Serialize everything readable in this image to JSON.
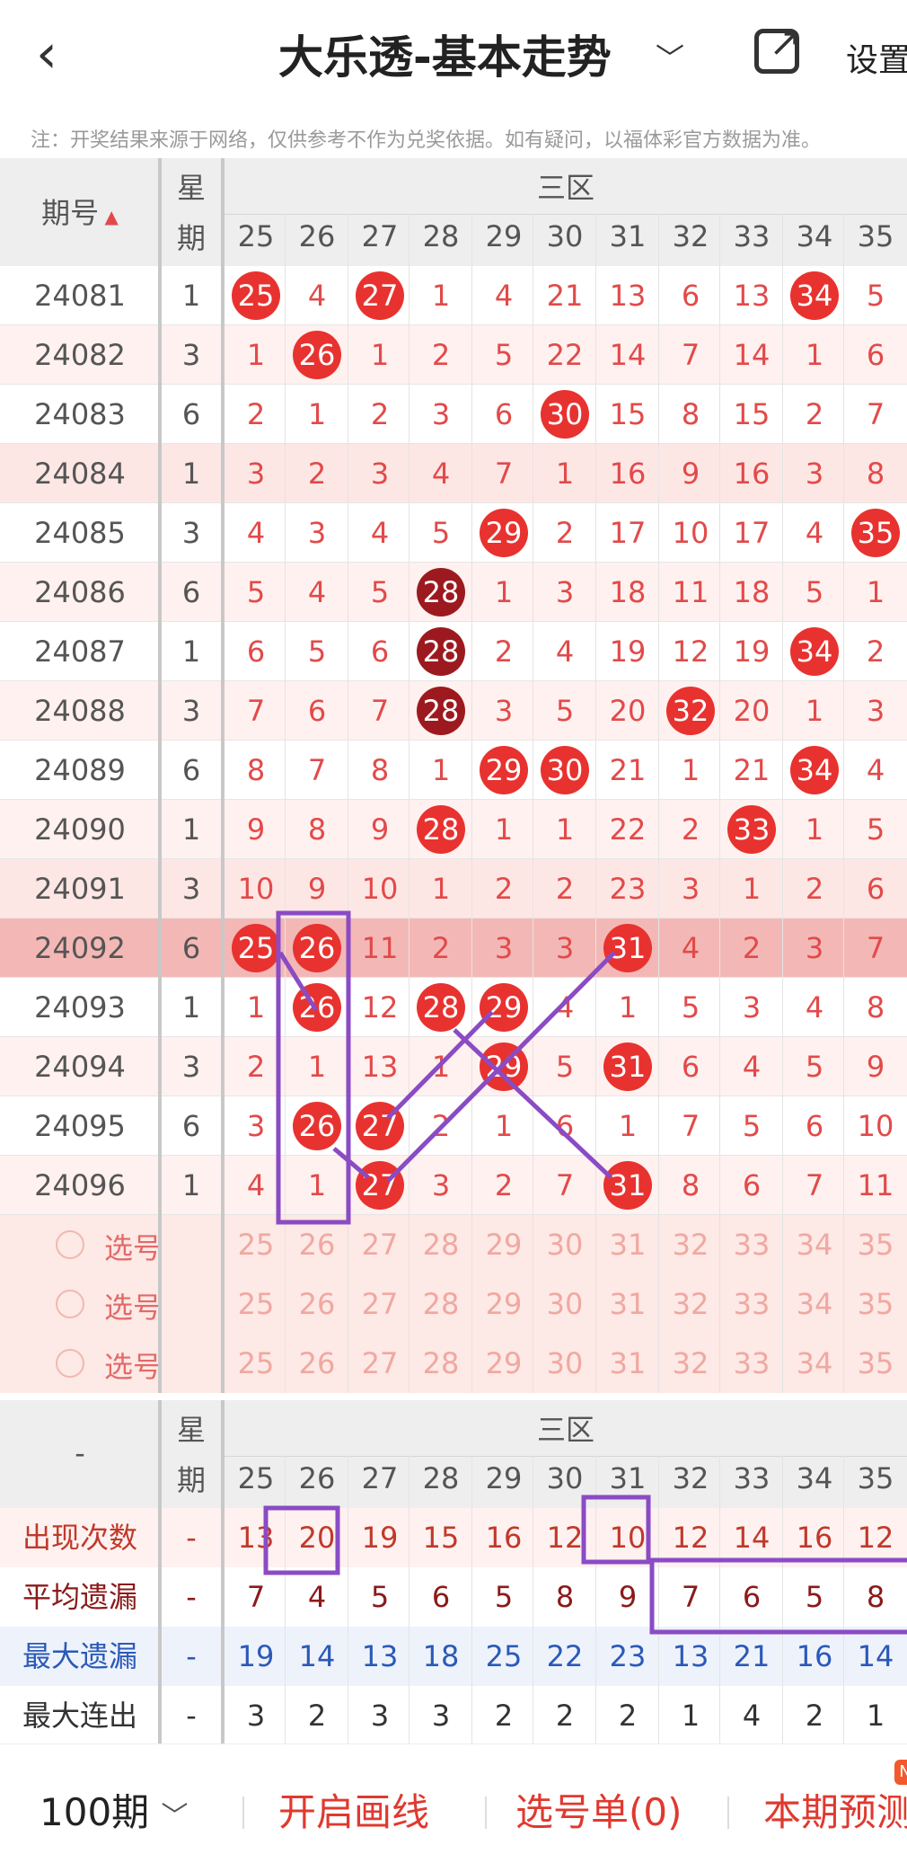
{
  "header": {
    "title": "大乐透-基本走势",
    "settings_label": "设置"
  },
  "note": "注：开奖结果来源于网络，仅供参考不作为兑奖依据。如有疑问，以福体彩官方数据为准。",
  "table": {
    "col_issue": "期号",
    "col_week": [
      "星",
      "期"
    ],
    "zone_label": "三区",
    "numbers": [
      "25",
      "26",
      "27",
      "28",
      "29",
      "30",
      "31",
      "32",
      "33",
      "34",
      "35"
    ],
    "rows": [
      {
        "issue": "24081",
        "week": "1",
        "cells": [
          "25",
          "4",
          "27",
          "1",
          "4",
          "21",
          "13",
          "6",
          "13",
          "34",
          "5"
        ],
        "hits": [
          0,
          2,
          9
        ],
        "bg": "#ffffff"
      },
      {
        "issue": "24082",
        "week": "3",
        "cells": [
          "1",
          "26",
          "1",
          "2",
          "5",
          "22",
          "14",
          "7",
          "14",
          "1",
          "6"
        ],
        "hits": [
          1
        ],
        "bg": "#fff1ef"
      },
      {
        "issue": "24083",
        "week": "6",
        "cells": [
          "2",
          "1",
          "2",
          "3",
          "6",
          "30",
          "15",
          "8",
          "15",
          "2",
          "7"
        ],
        "hits": [
          5
        ],
        "bg": "#ffffff"
      },
      {
        "issue": "24084",
        "week": "1",
        "cells": [
          "3",
          "2",
          "3",
          "4",
          "7",
          "1",
          "16",
          "9",
          "16",
          "3",
          "8"
        ],
        "hits": [],
        "bg": "#fde7e4"
      },
      {
        "issue": "24085",
        "week": "3",
        "cells": [
          "4",
          "3",
          "4",
          "5",
          "29",
          "2",
          "17",
          "10",
          "17",
          "4",
          "35"
        ],
        "hits": [
          4,
          10
        ],
        "bg": "#ffffff"
      },
      {
        "issue": "24086",
        "week": "6",
        "cells": [
          "5",
          "4",
          "5",
          "28",
          "1",
          "3",
          "18",
          "11",
          "18",
          "5",
          "1"
        ],
        "hits": [
          3
        ],
        "dark": [
          3
        ],
        "bg": "#fff1ef"
      },
      {
        "issue": "24087",
        "week": "1",
        "cells": [
          "6",
          "5",
          "6",
          "28",
          "2",
          "4",
          "19",
          "12",
          "19",
          "34",
          "2"
        ],
        "hits": [
          3,
          9
        ],
        "dark": [
          3
        ],
        "bg": "#ffffff"
      },
      {
        "issue": "24088",
        "week": "3",
        "cells": [
          "7",
          "6",
          "7",
          "28",
          "3",
          "5",
          "20",
          "32",
          "20",
          "1",
          "3"
        ],
        "hits": [
          3,
          7
        ],
        "dark": [
          3
        ],
        "bg": "#fff1ef"
      },
      {
        "issue": "24089",
        "week": "6",
        "cells": [
          "8",
          "7",
          "8",
          "1",
          "29",
          "30",
          "21",
          "1",
          "21",
          "34",
          "4"
        ],
        "hits": [
          4,
          5,
          9
        ],
        "bg": "#ffffff"
      },
      {
        "issue": "24090",
        "week": "1",
        "cells": [
          "9",
          "8",
          "9",
          "28",
          "1",
          "1",
          "22",
          "2",
          "33",
          "1",
          "5"
        ],
        "hits": [
          3,
          8
        ],
        "bg": "#fff1ef"
      },
      {
        "issue": "24091",
        "week": "3",
        "cells": [
          "10",
          "9",
          "10",
          "1",
          "2",
          "2",
          "23",
          "3",
          "1",
          "2",
          "6"
        ],
        "hits": [],
        "bg": "#fde7e4"
      },
      {
        "issue": "24092",
        "week": "6",
        "cells": [
          "25",
          "26",
          "11",
          "2",
          "3",
          "3",
          "31",
          "4",
          "2",
          "3",
          "7"
        ],
        "hits": [
          0,
          1,
          6
        ],
        "bg": "#f3b8b6"
      },
      {
        "issue": "24093",
        "week": "1",
        "cells": [
          "1",
          "26",
          "12",
          "28",
          "29",
          "4",
          "1",
          "5",
          "3",
          "4",
          "8"
        ],
        "hits": [
          1,
          3,
          4
        ],
        "bg": "#ffffff"
      },
      {
        "issue": "24094",
        "week": "3",
        "cells": [
          "2",
          "1",
          "13",
          "1",
          "29",
          "5",
          "31",
          "6",
          "4",
          "5",
          "9"
        ],
        "hits": [
          4,
          6
        ],
        "bg": "#fff1ef"
      },
      {
        "issue": "24095",
        "week": "6",
        "cells": [
          "3",
          "26",
          "27",
          "2",
          "1",
          "6",
          "1",
          "7",
          "5",
          "6",
          "10"
        ],
        "hits": [
          1,
          2
        ],
        "bg": "#ffffff"
      },
      {
        "issue": "24096",
        "week": "1",
        "cells": [
          "4",
          "1",
          "27",
          "3",
          "2",
          "7",
          "31",
          "8",
          "6",
          "7",
          "11"
        ],
        "hits": [
          2,
          6
        ],
        "bg": "#fff1ef"
      }
    ],
    "choose_rows": [
      {
        "label": "选号"
      },
      {
        "label": "选号"
      },
      {
        "label": "选号"
      }
    ]
  },
  "stats": {
    "dash": "-",
    "week_header": [
      "星",
      "期"
    ],
    "zone_label": "三区",
    "rows": [
      {
        "label": "出现次数",
        "color": "#c0392b",
        "week": "-",
        "values": [
          "13",
          "20",
          "19",
          "15",
          "16",
          "12",
          "10",
          "12",
          "14",
          "16",
          "12"
        ],
        "bg": "#fff1ef"
      },
      {
        "label": "平均遗漏",
        "color": "#8b1a1a",
        "week": "-",
        "values": [
          "7",
          "4",
          "5",
          "6",
          "5",
          "8",
          "9",
          "7",
          "6",
          "5",
          "8"
        ],
        "bg": "#ffffff"
      },
      {
        "label": "最大遗漏",
        "color": "#2a5ab8",
        "week": "-",
        "values": [
          "19",
          "14",
          "13",
          "18",
          "25",
          "22",
          "23",
          "13",
          "21",
          "16",
          "14"
        ],
        "bg": "#eef2fb"
      },
      {
        "label": "最大连出",
        "color": "#333333",
        "week": "-",
        "values": [
          "3",
          "2",
          "3",
          "3",
          "2",
          "2",
          "2",
          "1",
          "4",
          "2",
          "1"
        ],
        "bg": "#ffffff"
      }
    ]
  },
  "footer": {
    "period": "100期",
    "draw_line": "开启画线",
    "pick_list": "选号单(0)",
    "predict": "本期预测",
    "badge": "N"
  },
  "colors": {
    "ball": "#e8322f",
    "ball_dark": "#9c1a1f",
    "number_text": "#e24a4a",
    "accent_purple": "#8a4bc4"
  }
}
